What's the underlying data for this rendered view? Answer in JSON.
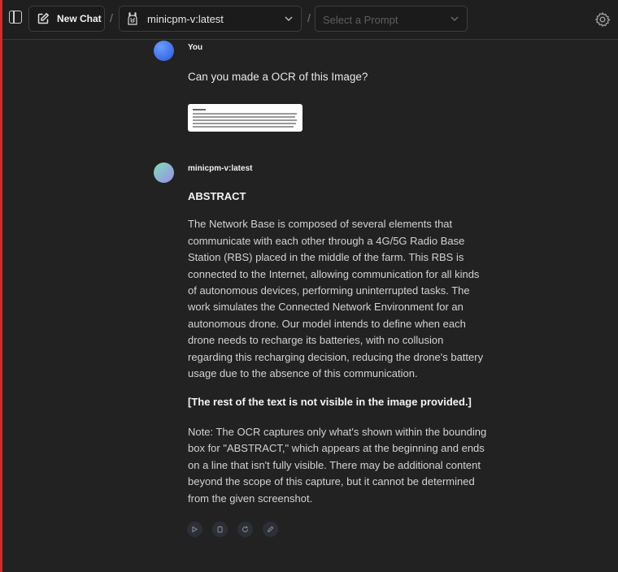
{
  "header": {
    "new_chat_label": "New Chat",
    "separator": "/",
    "model_name": "minicpm-v:latest",
    "prompt_placeholder": "Select a Prompt"
  },
  "messages": [
    {
      "sender": "You",
      "text": "Can you made a OCR of this Image?"
    },
    {
      "sender": "minicpm-v:latest",
      "heading": "ABSTRACT",
      "paragraph": "The Network Base is composed of several elements that communicate with each other through a 4G/5G Radio Base Station (RBS) placed in the middle of the farm. This RBS is connected to the Internet, allowing communication for all kinds of autonomous devices, performing uninterrupted tasks. The work simulates the Connected Network Environment for an autonomous drone. Our model intends to define when each drone needs to recharge its batteries, with no collusion regarding this recharging decision, reducing the drone's battery usage due to the absence of this communication.",
      "bold_note": "[The rest of the text is not visible in the image provided.]",
      "note": "Note: The OCR captures only what's shown within the bounding box for \"ABSTRACT,\" which appears at the beginning and ends on a line that isn't fully visible. There may be additional content beyond the scope of this capture, but it cannot be determined from the given screenshot."
    }
  ],
  "icons": {
    "sidebar": "sidebar-toggle-icon",
    "new_chat": "edit-icon",
    "model": "llama-icon",
    "chevron": "chevron-down-icon",
    "settings": "gear-icon",
    "actions": [
      "speak-icon",
      "copy-icon",
      "regenerate-icon",
      "edit-icon"
    ]
  },
  "colors": {
    "background": "#222222",
    "accent_border": "#d12b2b"
  }
}
